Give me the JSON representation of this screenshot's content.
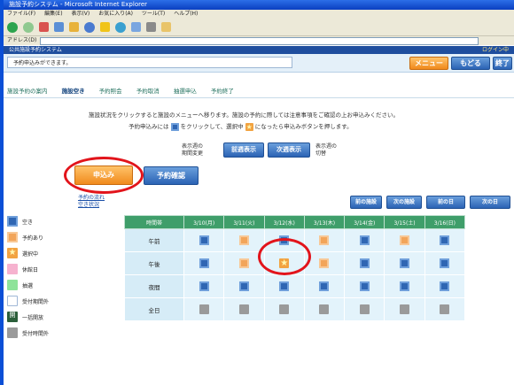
{
  "window": {
    "title": "施設予約システム - Microsoft Internet Explorer"
  },
  "menu": [
    "ファイル(F)",
    "編集(E)",
    "表示(V)",
    "お気に入り(A)",
    "ツール(T)",
    "ヘルプ(H)"
  ],
  "address": {
    "label": "アドレス(D)"
  },
  "site": {
    "title": "公共施設予約システム",
    "right_text": "ログイン中"
  },
  "band": {
    "message": "予約申込みができます。",
    "menu_button": "メニュー",
    "back_button": "もどる",
    "exit_button": "終了"
  },
  "nav": [
    "施設予約の案内",
    "施設空き",
    "予約照会",
    "予約取消",
    "抽選申込",
    "予約終了"
  ],
  "instructions": {
    "line1": "施設状況をクリックすると施設のメニューへ移ります。施設の予約に際しては注意事項をご確認の上お申込みください。",
    "line2_a": "予約申込みには",
    "line2_b": "をクリックして、選択中",
    "line2_c": "になったら申込みボタンを押します。"
  },
  "week": {
    "left_text_1": "表示週の",
    "left_text_2": "期間変更",
    "prev_button": "前週表示",
    "next_button": "次週表示",
    "right_text_1": "表示週の",
    "right_text_2": "切替"
  },
  "actions": {
    "apply_button": "申込み",
    "confirm_button": "予約確認"
  },
  "links": {
    "link1": "予約の流れ",
    "link2": "空き状況"
  },
  "paging": [
    "前の施設",
    "次の施設",
    "前の日",
    "次の日"
  ],
  "legend": [
    {
      "type": "free",
      "label": "空き"
    },
    {
      "type": "booked",
      "label": "予約あり"
    },
    {
      "type": "selected",
      "label": "選択中"
    },
    {
      "type": "closed",
      "label": "休館日"
    },
    {
      "type": "lottery",
      "label": "抽選"
    },
    {
      "type": "outside",
      "label": "受付期間外"
    },
    {
      "type": "open",
      "label": "一括開放",
      "glyph": "開"
    },
    {
      "type": "gray",
      "label": "受付時間外"
    }
  ],
  "table": {
    "corner": "時間帯",
    "columns": [
      "3/10(月)",
      "3/11(火)",
      "3/12(水)",
      "3/13(木)",
      "3/14(金)",
      "3/15(土)",
      "3/16(日)"
    ],
    "rows": [
      {
        "label": "午前",
        "cells": [
          "free",
          "booked",
          "free",
          "booked",
          "free",
          "booked",
          "free"
        ]
      },
      {
        "label": "午後",
        "cells": [
          "free",
          "booked",
          "selected",
          "booked",
          "free",
          "free",
          "free"
        ]
      },
      {
        "label": "夜間",
        "cells": [
          "free",
          "free",
          "free",
          "free",
          "free",
          "free",
          "free"
        ]
      },
      {
        "label": "全日",
        "cells": [
          "gray",
          "gray",
          "gray",
          "gray",
          "gray",
          "gray",
          "gray"
        ]
      }
    ]
  },
  "colors": {
    "header_blue": "#1f4e9e",
    "accent_orange": "#f08a1c",
    "button_blue": "#2b63b4",
    "table_header_green": "#3f9e6a",
    "highlight_red": "#e2141b"
  }
}
